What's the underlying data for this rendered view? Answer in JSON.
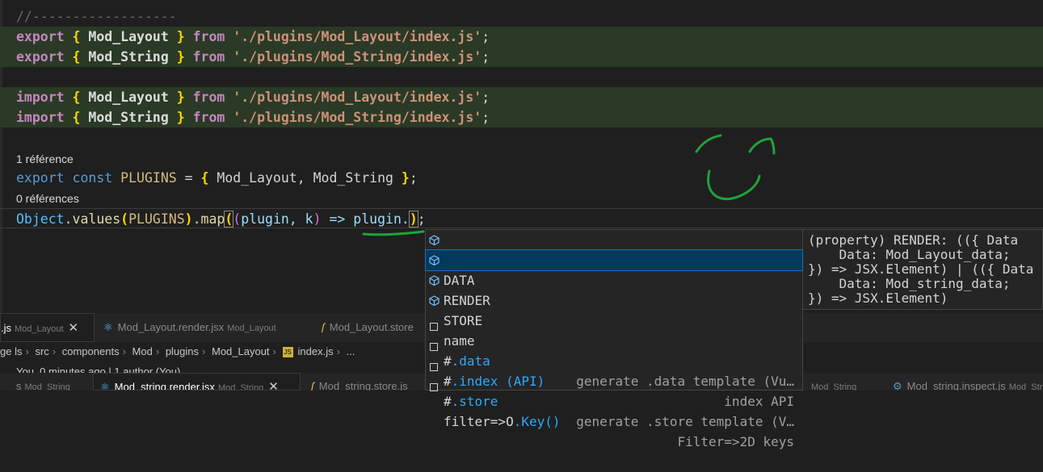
{
  "editor": {
    "comment": "//------------------",
    "exp_kw": "export",
    "imp_kw": "import",
    "from_kw": "from",
    "ob": "{",
    "cb": "}",
    "semi": ";",
    "mod_layout": "Mod_Layout",
    "mod_string": "Mod_String",
    "path_layout": "'./plugins/Mod_Layout/index.js'",
    "path_string": "'./plugins/Mod_String/index.js'",
    "codelens1": "1 référence",
    "codelens2": "0 références",
    "const_line": {
      "export": "export",
      "const": "const",
      "name": "PLUGINS",
      "eq": " = ",
      "ob": "{",
      "members": " Mod_Layout, Mod_String ",
      "cb": "}",
      "semi": ";"
    },
    "map_line": {
      "object": "Object",
      "dot1": ".",
      "values": "values",
      "p1o": "(",
      "arg": "PLUGINS",
      "p1c": ")",
      "dot2": ".",
      "map": "map",
      "p2o": "(",
      "p3o": "(",
      "params": "plugin, k",
      "p3c": ")",
      "arrow": " => plugin.",
      "p2c": ")",
      "semi": ";"
    }
  },
  "suggestions": [
    {
      "label": "DATA",
      "detail": "",
      "kind": "property"
    },
    {
      "label": "RENDER",
      "detail": "",
      "kind": "property"
    },
    {
      "label": "STORE",
      "detail": "",
      "kind": "property"
    },
    {
      "label": "name",
      "detail": "",
      "kind": "property"
    },
    {
      "label_pre": "#",
      "label_rest": ".data",
      "detail": "generate .data template (Vu…",
      "kind": "snippet"
    },
    {
      "label_pre": "#",
      "label_rest": ".index (API)",
      "detail": "index API",
      "kind": "snippet"
    },
    {
      "label_pre": "#",
      "label_rest": ".store",
      "detail": "generate .store template (V…",
      "kind": "snippet"
    },
    {
      "label_pre": "filter=>O",
      "label_rest": ".Key()",
      "detail": "Filter=>2D keys",
      "kind": "snippet"
    }
  ],
  "detail_panel": {
    "l1": "(property) RENDER: (({ Data",
    "l2": "    Data: Mod_Layout_data;",
    "l3": "}) => JSX.Element) | (({ Data",
    "l4": "    Data: Mod_string_data;",
    "l5": "}) => JSX.Element)"
  },
  "tabs_top": [
    {
      "name": ".js",
      "desc": "Mod_Layout",
      "close": "✕"
    },
    {
      "name": "Mod_Layout.render.jsx",
      "desc": "Mod_Layout"
    },
    {
      "name": "Mod_Layout.store",
      "desc": ""
    }
  ],
  "breadcrumb": [
    "ge ls",
    "src",
    "components",
    "Mod",
    "plugins",
    "Mod_Layout",
    "index.js",
    "..."
  ],
  "breadcrumb_js": "JS",
  "blame": "You, 0 minutes ago | 1 author (You)",
  "tabs_bottom": [
    {
      "name": "s",
      "desc": "Mod_String"
    },
    {
      "name": "Mod_string.render.jsx",
      "desc": "Mod_String",
      "close": "✕"
    },
    {
      "name": "Mod_string.store.js",
      "desc": ""
    },
    {
      "name": "",
      "desc": "Mod_String"
    },
    {
      "name": "Mod_string.inspect.js",
      "desc": "Mod_Strin"
    }
  ]
}
